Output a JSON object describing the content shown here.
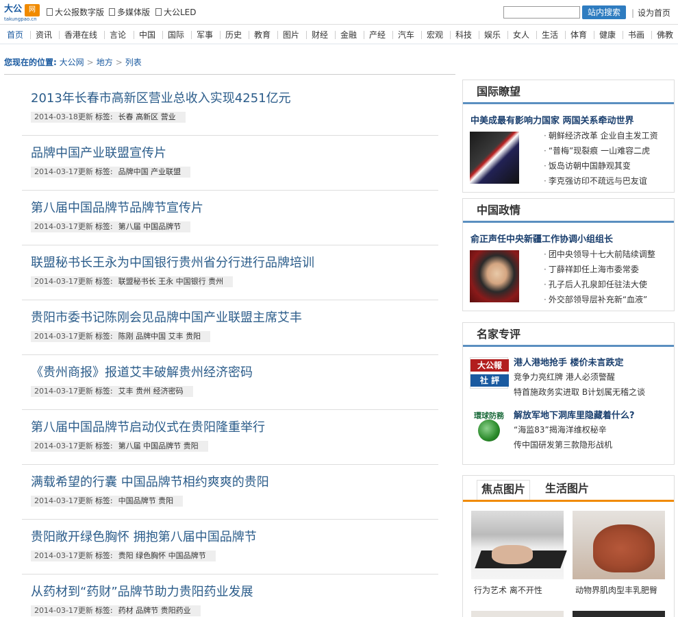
{
  "topbar": {
    "logo_main": "大公",
    "logo_badge": "网",
    "logo_url": "takungpao.cn",
    "links": [
      "大公报数字版",
      "多媒体版",
      "大公LED"
    ],
    "search_placeholder": "",
    "search_button": "站内搜索",
    "set_home": "设为首页",
    "separator": "|"
  },
  "nav": {
    "items": [
      "首页",
      "资讯",
      "香港在线",
      "言论",
      "中国",
      "国际",
      "军事",
      "历史",
      "教育",
      "图片",
      "财经",
      "金融",
      "产经",
      "汽车",
      "宏观",
      "科技",
      "娱乐",
      "女人",
      "生活",
      "体育",
      "健康",
      "书画",
      "佛教"
    ]
  },
  "breadcrumb": {
    "label": "您现在的位置:",
    "crumbs": [
      "大公网",
      "地方",
      "列表"
    ],
    "arrow": ">"
  },
  "articles": [
    {
      "title": "2013年长春市高新区营业总收入实现4251亿元",
      "date": "2014-03-18更新",
      "tag_label": "标签:",
      "tags": "长春 高新区 营业"
    },
    {
      "title": "品牌中国产业联盟宣传片",
      "date": "2014-03-17更新",
      "tag_label": "标签:",
      "tags": "品牌中国 产业联盟"
    },
    {
      "title": "第八届中国品牌节品牌节宣传片",
      "date": "2014-03-17更新",
      "tag_label": "标签:",
      "tags": "第八届 中国品牌节"
    },
    {
      "title": "联盟秘书长王永为中国银行贵州省分行进行品牌培训",
      "date": "2014-03-17更新",
      "tag_label": "标签:",
      "tags": "联盟秘书长 王永 中国银行 贵州"
    },
    {
      "title": "贵阳市委书记陈刚会见品牌中国产业联盟主席艾丰",
      "date": "2014-03-17更新",
      "tag_label": "标签:",
      "tags": "陈刚 品牌中国 艾丰 贵阳"
    },
    {
      "title": "《贵州商报》报道艾丰破解贵州经济密码",
      "date": "2014-03-17更新",
      "tag_label": "标签:",
      "tags": "艾丰 贵州 经济密码"
    },
    {
      "title": "第八届中国品牌节启动仪式在贵阳隆重举行",
      "date": "2014-03-17更新",
      "tag_label": "标签:",
      "tags": "第八届 中国品牌节 贵阳"
    },
    {
      "title": "满载希望的行囊 中国品牌节相约爽爽的贵阳",
      "date": "2014-03-17更新",
      "tag_label": "标签:",
      "tags": "中国品牌节 贵阳"
    },
    {
      "title": "贵阳敞开绿色胸怀 拥抱第八届中国品牌节",
      "date": "2014-03-17更新",
      "tag_label": "标签:",
      "tags": "贵阳 绿色胸怀 中国品牌节"
    },
    {
      "title": "从药材到“药财”品牌节助力贵阳药业发展",
      "date": "2014-03-17更新",
      "tag_label": "标签:",
      "tags": "药材 品牌节 贵阳药业"
    }
  ],
  "intl": {
    "heading": "国际瞭望",
    "headline": "中美成最有影响力国家 两国关系牵动世界",
    "items": [
      "朝鲜经济改革 企业自主发工资",
      "“普梅”现裂痕 一山难容二虎",
      "饭岛访朝中国静观其变",
      "李克强访印不疏远与巴友谊"
    ]
  },
  "china": {
    "heading": "中国政情",
    "headline": "俞正声任中央新疆工作协调小组组长",
    "items": [
      "团中央领导十七大前陆续调整",
      "丁薛祥卸任上海市委常委",
      "孔子后人孔泉卸任驻法大使",
      "外交部领导层补充新“血液”"
    ]
  },
  "experts": {
    "heading": "名家专评",
    "logo1_top": "大公報",
    "logo1_bottom": "社 評",
    "logo2_text": "環球防務",
    "rows": [
      {
        "title": "港人港地抢手 楼价未言跌定",
        "lines": [
          "竞争力亮红牌 港人必须警醒",
          "特首施政务实进取 B计划属无稽之谈"
        ]
      },
      {
        "title": "解放军地下洞库里隐藏着什么?",
        "lines": [
          "“海监83”揭海洋维权秘辛",
          "传中国研发第三款隐形战机"
        ]
      }
    ]
  },
  "photos": {
    "tabs": [
      "焦点图片",
      "生活图片"
    ],
    "captions": [
      "行为艺术 离不开性",
      "动物界肌肉型丰乳肥臀"
    ]
  },
  "bullet": "·"
}
